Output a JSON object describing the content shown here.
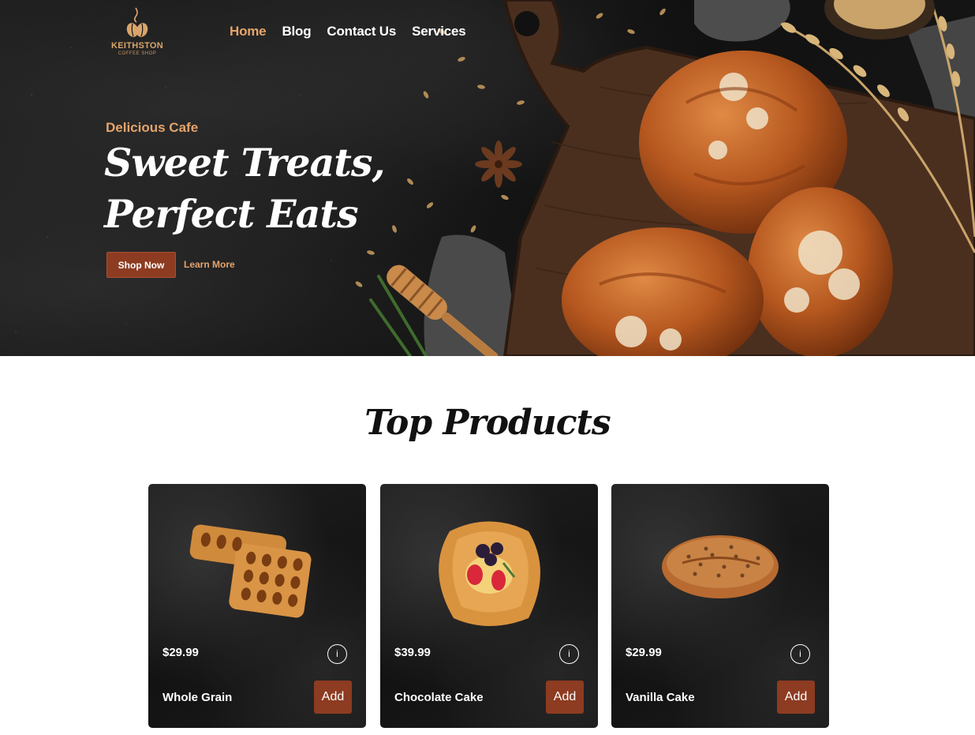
{
  "brand": {
    "name": "KEITHSTON",
    "tagline": "COFFEE SHOP"
  },
  "nav": {
    "items": [
      {
        "label": "Home",
        "active": true
      },
      {
        "label": "Blog",
        "active": false
      },
      {
        "label": "Contact Us",
        "active": false
      },
      {
        "label": "Services",
        "active": false
      }
    ]
  },
  "hero": {
    "eyebrow": "Delicious Cafe",
    "headline_line1": "Sweet Treats,",
    "headline_line2": "Perfect Eats",
    "primary_cta": "Shop Now",
    "secondary_cta": "Learn More"
  },
  "products_section": {
    "title": "Top Products",
    "products": [
      {
        "price": "$29.99",
        "name": "Whole Grain",
        "info_icon": "i",
        "add_label": "Add",
        "image": "lattice-pastry"
      },
      {
        "price": "$39.99",
        "name": "Chocolate Cake",
        "info_icon": "i",
        "add_label": "Add",
        "image": "berry-danish"
      },
      {
        "price": "$29.99",
        "name": "Vanilla Cake",
        "info_icon": "i",
        "add_label": "Add",
        "image": "seeded-loaf"
      }
    ]
  },
  "colors": {
    "accent": "#e5a46b",
    "button": "#8d3b21",
    "hero_bg": "#141414",
    "card_bg": "#161616"
  }
}
